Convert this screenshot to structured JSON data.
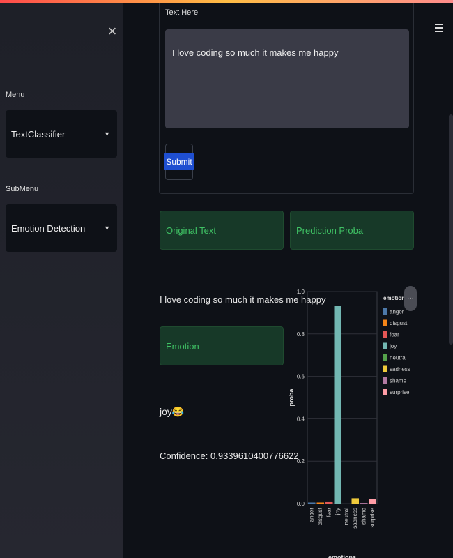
{
  "sidebar": {
    "menu_label": "Menu",
    "menu_selected": "TextClassifier",
    "submenu_label": "SubMenu",
    "submenu_selected": "Emotion Detection"
  },
  "form": {
    "label": "Text Here",
    "text_value": "I love coding so much it makes me happy",
    "submit_label": "Submit"
  },
  "results": {
    "original_text_header": "Original Text",
    "prediction_proba_header": "Prediction Proba",
    "original_text": "I love coding so much it makes me happy",
    "emotion_header": "Emotion",
    "emotion_value": "joy😂",
    "confidence_text": "Confidence: 0.9339610400776622"
  },
  "chart_data": {
    "type": "bar",
    "categories": [
      "anger",
      "disgust",
      "fear",
      "joy",
      "neutral",
      "sadness",
      "shame",
      "surprise"
    ],
    "values": [
      0.005,
      0.005,
      0.01,
      0.934,
      0.0,
      0.025,
      0.003,
      0.02
    ],
    "colors": [
      "#4c78a8",
      "#f58518",
      "#e45756",
      "#72b7b2",
      "#54a24b",
      "#eeca3b",
      "#b279a2",
      "#ff9da6"
    ],
    "xlabel": "emotions",
    "ylabel": "proba",
    "ylim": [
      0,
      1
    ],
    "yticks": [
      "0.0",
      "0.2",
      "0.4",
      "0.6",
      "0.8",
      "1.0"
    ],
    "legend_title": "emotions",
    "legend_position": "right",
    "grid": true
  }
}
